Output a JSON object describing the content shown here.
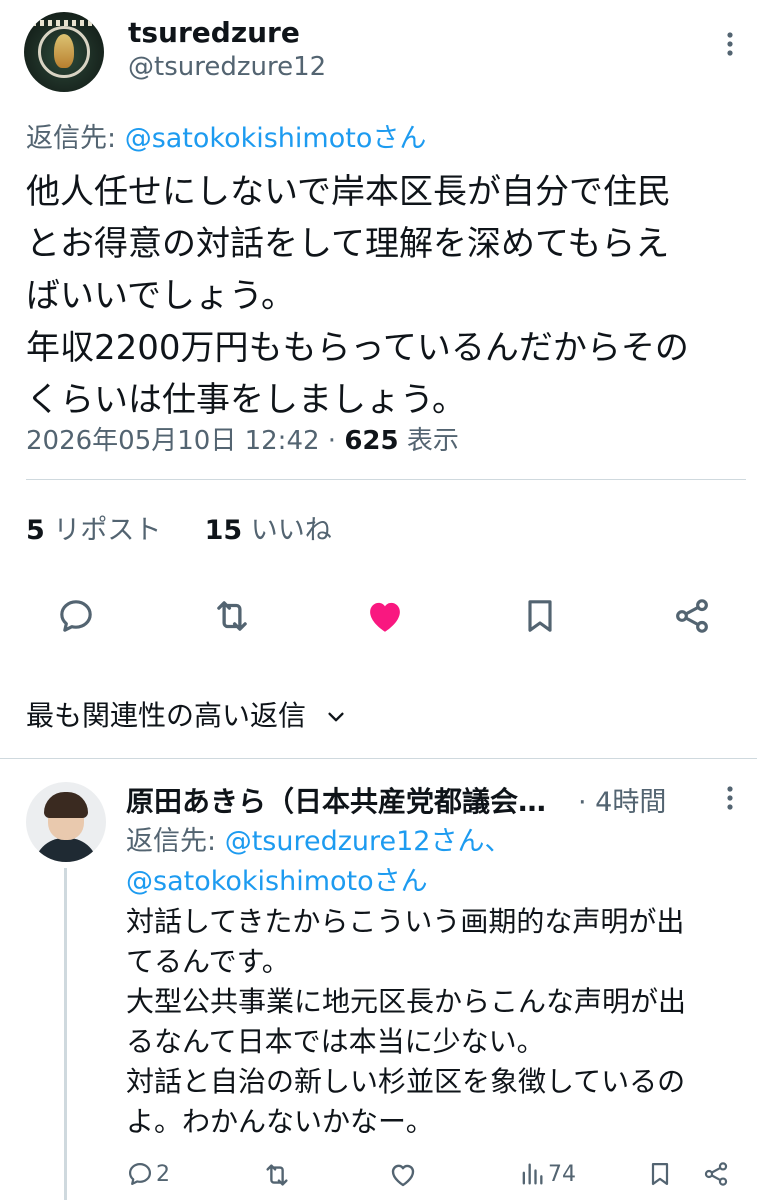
{
  "tweet": {
    "display_name": "tsuredzure",
    "handle": "@tsuredzure12",
    "reply_prefix": "返信先: ",
    "reply_mention": "@satokokishimotoさん",
    "text_lines": [
      "他人任せにしないで岸本区長が自分で住民",
      "とお得意の対話をして理解を深めてもらえ",
      "ばいいでしょう。",
      "年収2200万円ももらっているんだからその",
      "くらいは仕事をしましょう。"
    ],
    "timestamp": "2026年05月10日 12:42",
    "separator": " · ",
    "views_count": "625",
    "views_label": " 表示",
    "reposts_count": "5",
    "reposts_label": " リポスト",
    "likes_count": "15",
    "likes_label": " いいね"
  },
  "replies_section": {
    "title": "最も関連性の高い返信"
  },
  "reply": {
    "display_name": "原田あきら（日本共産党都議会…",
    "time": " · 4時間",
    "reply_prefix": "返信先: ",
    "mention1": "@tsuredzure12さん、",
    "mention2": "@satokokishimotoさん",
    "text_lines": [
      "対話してきたからこういう画期的な声明が出",
      "てるんです。",
      "大型公共事業に地元区長からこんな声明が出",
      "るなんて日本では本当に少ない。",
      "対話と自治の新しい杉並区を象徴しているの",
      "よ。わかんないかなー。"
    ],
    "reply_count": "2",
    "views_count": "74"
  },
  "colors": {
    "like_active": "#f91880",
    "link": "#1d9bf0",
    "secondary_text": "#536471"
  }
}
